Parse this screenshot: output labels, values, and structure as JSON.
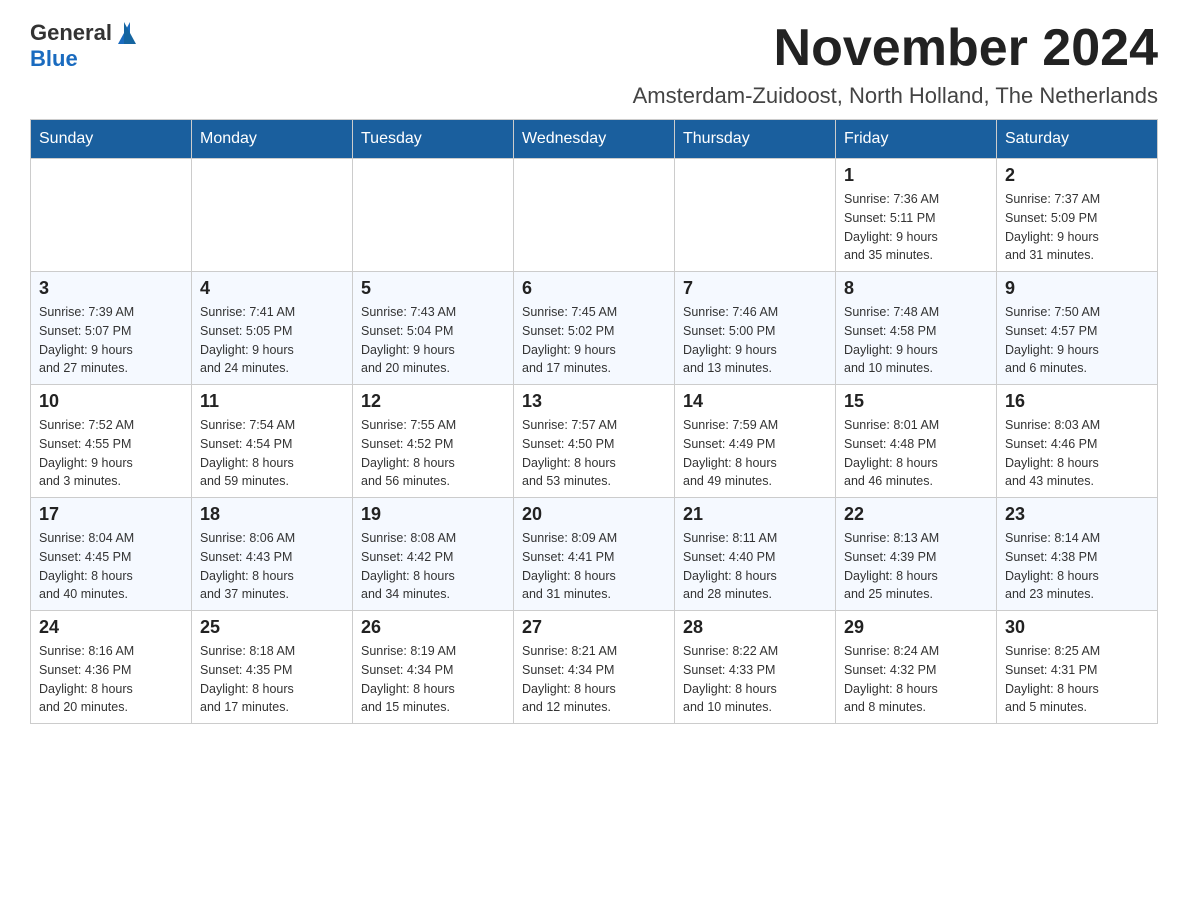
{
  "header": {
    "logo_general": "General",
    "logo_blue": "Blue",
    "title": "November 2024",
    "subtitle": "Amsterdam-Zuidoost, North Holland, The Netherlands"
  },
  "weekdays": [
    "Sunday",
    "Monday",
    "Tuesday",
    "Wednesday",
    "Thursday",
    "Friday",
    "Saturday"
  ],
  "weeks": [
    [
      {
        "day": "",
        "info": ""
      },
      {
        "day": "",
        "info": ""
      },
      {
        "day": "",
        "info": ""
      },
      {
        "day": "",
        "info": ""
      },
      {
        "day": "",
        "info": ""
      },
      {
        "day": "1",
        "info": "Sunrise: 7:36 AM\nSunset: 5:11 PM\nDaylight: 9 hours\nand 35 minutes."
      },
      {
        "day": "2",
        "info": "Sunrise: 7:37 AM\nSunset: 5:09 PM\nDaylight: 9 hours\nand 31 minutes."
      }
    ],
    [
      {
        "day": "3",
        "info": "Sunrise: 7:39 AM\nSunset: 5:07 PM\nDaylight: 9 hours\nand 27 minutes."
      },
      {
        "day": "4",
        "info": "Sunrise: 7:41 AM\nSunset: 5:05 PM\nDaylight: 9 hours\nand 24 minutes."
      },
      {
        "day": "5",
        "info": "Sunrise: 7:43 AM\nSunset: 5:04 PM\nDaylight: 9 hours\nand 20 minutes."
      },
      {
        "day": "6",
        "info": "Sunrise: 7:45 AM\nSunset: 5:02 PM\nDaylight: 9 hours\nand 17 minutes."
      },
      {
        "day": "7",
        "info": "Sunrise: 7:46 AM\nSunset: 5:00 PM\nDaylight: 9 hours\nand 13 minutes."
      },
      {
        "day": "8",
        "info": "Sunrise: 7:48 AM\nSunset: 4:58 PM\nDaylight: 9 hours\nand 10 minutes."
      },
      {
        "day": "9",
        "info": "Sunrise: 7:50 AM\nSunset: 4:57 PM\nDaylight: 9 hours\nand 6 minutes."
      }
    ],
    [
      {
        "day": "10",
        "info": "Sunrise: 7:52 AM\nSunset: 4:55 PM\nDaylight: 9 hours\nand 3 minutes."
      },
      {
        "day": "11",
        "info": "Sunrise: 7:54 AM\nSunset: 4:54 PM\nDaylight: 8 hours\nand 59 minutes."
      },
      {
        "day": "12",
        "info": "Sunrise: 7:55 AM\nSunset: 4:52 PM\nDaylight: 8 hours\nand 56 minutes."
      },
      {
        "day": "13",
        "info": "Sunrise: 7:57 AM\nSunset: 4:50 PM\nDaylight: 8 hours\nand 53 minutes."
      },
      {
        "day": "14",
        "info": "Sunrise: 7:59 AM\nSunset: 4:49 PM\nDaylight: 8 hours\nand 49 minutes."
      },
      {
        "day": "15",
        "info": "Sunrise: 8:01 AM\nSunset: 4:48 PM\nDaylight: 8 hours\nand 46 minutes."
      },
      {
        "day": "16",
        "info": "Sunrise: 8:03 AM\nSunset: 4:46 PM\nDaylight: 8 hours\nand 43 minutes."
      }
    ],
    [
      {
        "day": "17",
        "info": "Sunrise: 8:04 AM\nSunset: 4:45 PM\nDaylight: 8 hours\nand 40 minutes."
      },
      {
        "day": "18",
        "info": "Sunrise: 8:06 AM\nSunset: 4:43 PM\nDaylight: 8 hours\nand 37 minutes."
      },
      {
        "day": "19",
        "info": "Sunrise: 8:08 AM\nSunset: 4:42 PM\nDaylight: 8 hours\nand 34 minutes."
      },
      {
        "day": "20",
        "info": "Sunrise: 8:09 AM\nSunset: 4:41 PM\nDaylight: 8 hours\nand 31 minutes."
      },
      {
        "day": "21",
        "info": "Sunrise: 8:11 AM\nSunset: 4:40 PM\nDaylight: 8 hours\nand 28 minutes."
      },
      {
        "day": "22",
        "info": "Sunrise: 8:13 AM\nSunset: 4:39 PM\nDaylight: 8 hours\nand 25 minutes."
      },
      {
        "day": "23",
        "info": "Sunrise: 8:14 AM\nSunset: 4:38 PM\nDaylight: 8 hours\nand 23 minutes."
      }
    ],
    [
      {
        "day": "24",
        "info": "Sunrise: 8:16 AM\nSunset: 4:36 PM\nDaylight: 8 hours\nand 20 minutes."
      },
      {
        "day": "25",
        "info": "Sunrise: 8:18 AM\nSunset: 4:35 PM\nDaylight: 8 hours\nand 17 minutes."
      },
      {
        "day": "26",
        "info": "Sunrise: 8:19 AM\nSunset: 4:34 PM\nDaylight: 8 hours\nand 15 minutes."
      },
      {
        "day": "27",
        "info": "Sunrise: 8:21 AM\nSunset: 4:34 PM\nDaylight: 8 hours\nand 12 minutes."
      },
      {
        "day": "28",
        "info": "Sunrise: 8:22 AM\nSunset: 4:33 PM\nDaylight: 8 hours\nand 10 minutes."
      },
      {
        "day": "29",
        "info": "Sunrise: 8:24 AM\nSunset: 4:32 PM\nDaylight: 8 hours\nand 8 minutes."
      },
      {
        "day": "30",
        "info": "Sunrise: 8:25 AM\nSunset: 4:31 PM\nDaylight: 8 hours\nand 5 minutes."
      }
    ]
  ]
}
